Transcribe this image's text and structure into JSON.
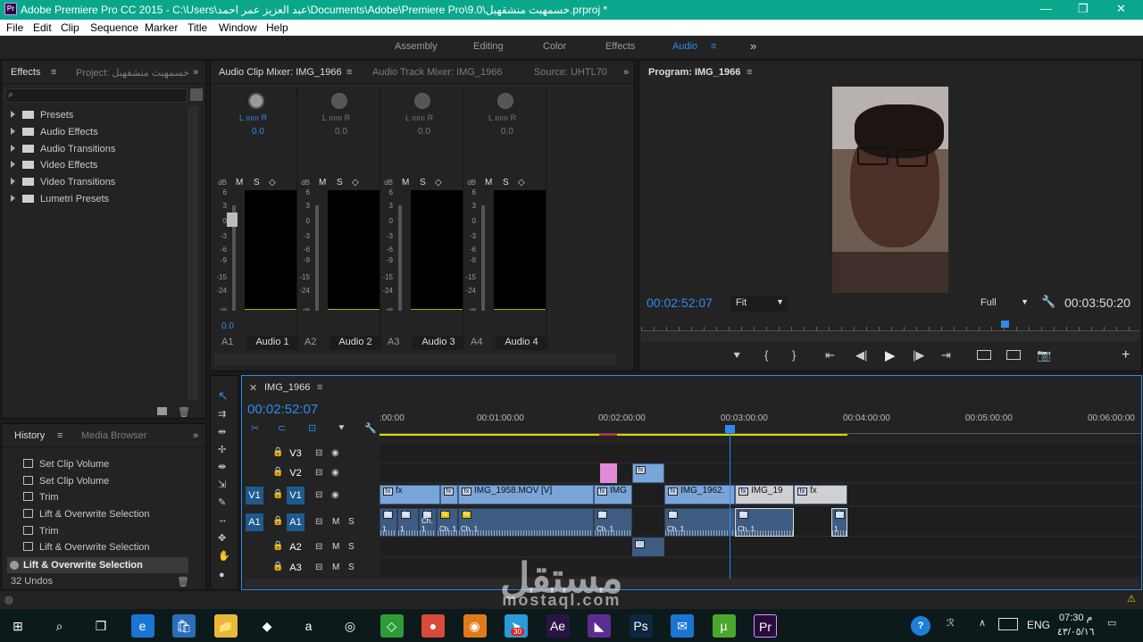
{
  "window": {
    "app_icon": "Pr",
    "title": "Adobe Premiere Pro CC 2015 - C:\\Users\\عبد العزيز عمر احمد\\Documents\\Adobe\\Premiere Pro\\9.0\\خسمهبث منشقهبل.prproj *",
    "minimize": "—",
    "maximize": "❐",
    "close": "✕"
  },
  "menu": [
    "File",
    "Edit",
    "Clip",
    "Sequence",
    "Marker",
    "Title",
    "Window",
    "Help"
  ],
  "workspaces": {
    "items": [
      "Assembly",
      "Editing",
      "Color",
      "Effects",
      "Audio"
    ],
    "active": "Audio",
    "more": "»",
    "menu_glyph": "≡"
  },
  "effects_panel": {
    "tab_effects": "Effects",
    "tab_project": "Project: خسمهبث منشقهبل",
    "items": [
      "Presets",
      "Audio Effects",
      "Audio Transitions",
      "Video Effects",
      "Video Transitions",
      "Lumetri Presets"
    ]
  },
  "history_panel": {
    "tab_history": "History",
    "tab_media": "Media Browser",
    "items": [
      "Set Clip Volume",
      "Set Clip Volume",
      "Trim",
      "Lift & Overwrite Selection",
      "Trim",
      "Lift & Overwrite Selection",
      "Lift & Overwrite Selection"
    ],
    "undos": "32 Undos"
  },
  "mixer_panel": {
    "tab_clip_mixer": "Audio Clip Mixer: IMG_1966",
    "tab_track_mixer": "Audio Track Mixer: IMG_1966",
    "tab_source": "Source: UHTL70",
    "channels": [
      {
        "id": "A1",
        "name": "Audio 1",
        "pan": "0.0",
        "level": "0.0"
      },
      {
        "id": "A2",
        "name": "Audio 2",
        "pan": "0.0",
        "level": ""
      },
      {
        "id": "A3",
        "name": "Audio 3",
        "pan": "0.0",
        "level": ""
      },
      {
        "id": "A4",
        "name": "Audio 4",
        "pan": "0.0",
        "level": ""
      }
    ],
    "scale": [
      "dB",
      "6",
      "3",
      "0",
      "-3",
      "-6",
      "-9",
      "-15",
      "-24",
      "-∞"
    ],
    "lr": "L ıııııı R",
    "msb": [
      "M",
      "S",
      "◇"
    ]
  },
  "program_monitor": {
    "title": "Program: IMG_1966",
    "timecode": "00:02:52:07",
    "fit": "Fit",
    "quality": "Full",
    "duration": "00:03:50:20",
    "playhead_fraction": 0.73,
    "controls": [
      "marker-icon",
      "mark-in-icon",
      "mark-out-icon",
      "go-to-in-icon",
      "step-back-icon",
      "play-icon",
      "step-forward-icon",
      "go-to-out-icon",
      "lift-icon",
      "extract-icon",
      "export-frame-icon",
      "add-button-icon"
    ]
  },
  "timeline": {
    "tab": "IMG_1966",
    "timecode": "00:02:52:07",
    "ruler": [
      ":00:00",
      "00:01:00:00",
      "00:02:00:00",
      "00:03:00:00",
      "00:04:00:00",
      "00:05:00:00",
      "00:06:00:00"
    ],
    "tracks": [
      {
        "label": "V3",
        "type": "video"
      },
      {
        "label": "V2",
        "type": "video"
      },
      {
        "label": "V1",
        "type": "video",
        "src": "V1"
      },
      {
        "label": "A1",
        "type": "audio",
        "src": "A1"
      },
      {
        "label": "A2",
        "type": "audio"
      },
      {
        "label": "A3",
        "type": "audio"
      }
    ],
    "clips_v1": [
      "fx",
      "fx",
      "IMG_1958.MOV [V]",
      "IMG",
      "IMG_1962.",
      "IMG_19",
      "fx"
    ],
    "clips_a1": [
      "1",
      "1",
      "Ch. 1",
      "Ch. 1",
      "Ch. 1",
      "Ch. 1",
      "Ch. 1",
      "Ch. 1",
      "1"
    ],
    "track_buttons": {
      "lock": "🔒",
      "eye": "👁",
      "mute": "M",
      "solo": "S"
    }
  },
  "taskbar": {
    "lang": "ENG",
    "time": "07:30 م",
    "date": "٤٣/٠٥/١٦",
    "apps": [
      "windows-icon",
      "search-icon",
      "task-view-icon",
      "edge-icon",
      "store-icon",
      "file-explorer-icon",
      "dropbox-icon",
      "amazon-icon",
      "tripadvisor-icon",
      "layers-icon",
      "chrome-icon",
      "blender-icon",
      "telegram-icon",
      "after-effects-icon",
      "vs-icon",
      "photoshop-icon",
      "mail-icon",
      "utorrent-icon",
      "premiere-icon"
    ],
    "telegram_badge": "30"
  },
  "watermark": {
    "arabic": "مستقل",
    "latin": "mostaql.com"
  },
  "colors": {
    "titlebar": "#0aa78d",
    "accent": "#2d8ceb",
    "timecode": "#2d8ceb",
    "video_clip": "#7aa5d8",
    "audio_clip": "#3e5c82",
    "adjustment": "#e08ad8",
    "track_target": "#1d5b8e"
  }
}
